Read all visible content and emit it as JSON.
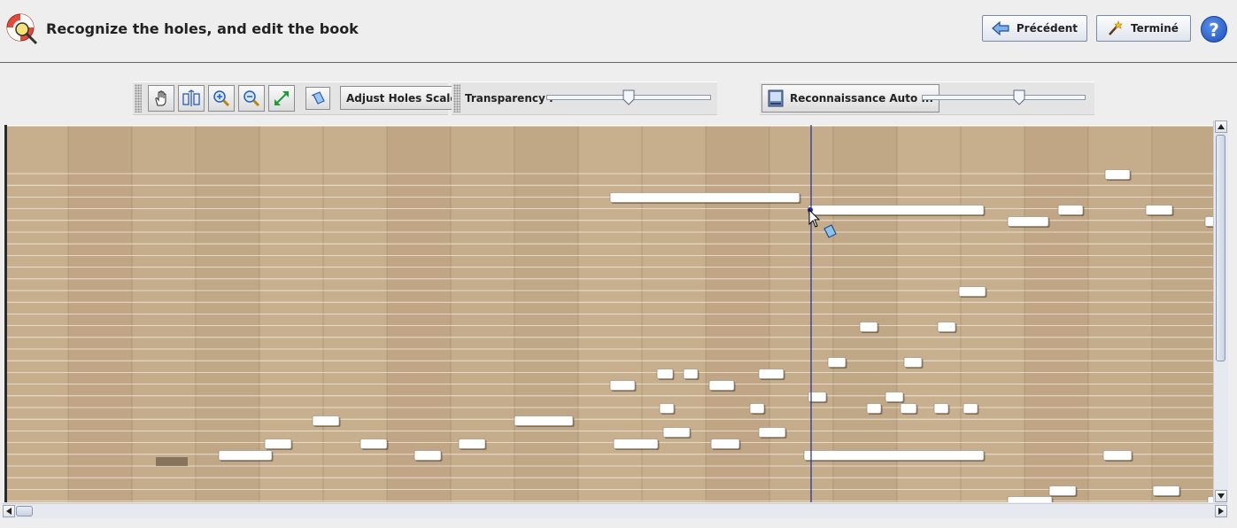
{
  "header": {
    "title": "Recognize the holes, and edit the book",
    "previous_label": "Précédent",
    "done_label": "Terminé",
    "help_label": "?"
  },
  "toolbar": {
    "adjust_label": "Adjust Holes Scale",
    "transparency_label": "Transparency :",
    "transparency_value": 0.5,
    "auto_label": "Reconnaissance Auto ...",
    "auto_value": 0.6
  },
  "icons": {
    "app": "magic-lifebuoy-icon",
    "previous": "arrow-left-icon",
    "done": "magic-wand-icon",
    "help": "question-icon",
    "hand": "hand-icon",
    "fit": "fit-width-icon",
    "zoom_in": "zoom-in-icon",
    "zoom_out": "zoom-out-icon",
    "expand": "expand-icon",
    "eraser": "eraser-icon",
    "auto": "scanner-icon"
  },
  "colors": {
    "cardboard": "#c3aa88",
    "hole": "#ffffff",
    "cursor_line": "#1f2c9e",
    "selection_start": "#1f2c9e"
  }
}
